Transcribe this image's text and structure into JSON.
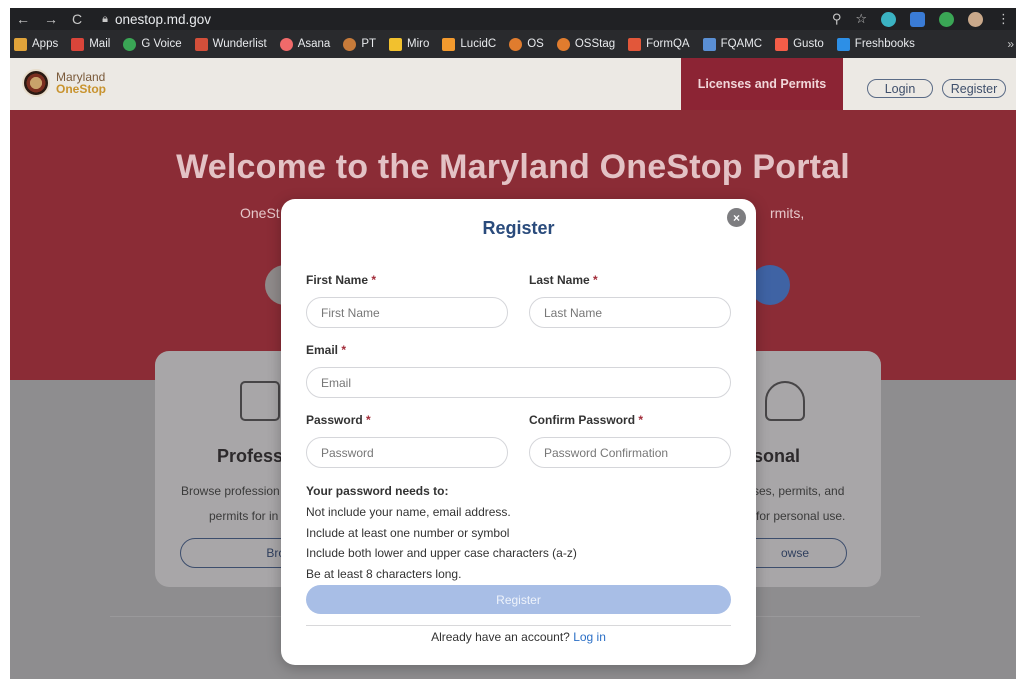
{
  "browser": {
    "url": "onestop.md.gov",
    "bookmarks": [
      "Apps",
      "Mail",
      "G Voice",
      "Wunderlist",
      "Asana",
      "PT",
      "Miro",
      "LucidC",
      "OS",
      "OSStag",
      "FormQA",
      "FQAMC",
      "Gusto",
      "Freshbooks"
    ],
    "more": "»"
  },
  "header": {
    "logo_line1": "Maryland",
    "logo_line2": "OneStop",
    "tab_licenses": "Licenses and Permits",
    "login": "Login",
    "register": "Register"
  },
  "hero": {
    "title": "Welcome to the Maryland OneStop Portal",
    "sub_left": "OneSt",
    "sub_right": "rmits,"
  },
  "cards": {
    "left_title": "Profess",
    "left_text1": "Browse profession",
    "left_text2": "permits for in",
    "left_btn": "Brow",
    "right_title": "sonal",
    "right_text1": "ses, permits, and",
    "right_text2": "for personal use.",
    "right_btn": "owse"
  },
  "modal": {
    "title": "Register",
    "close": "×",
    "first_name_label": "First Name",
    "first_name_placeholder": "First Name",
    "last_name_label": "Last Name",
    "last_name_placeholder": "Last Name",
    "email_label": "Email",
    "email_placeholder": "Email",
    "password_label": "Password",
    "password_placeholder": "Password",
    "confirm_label": "Confirm Password",
    "confirm_placeholder": "Password Confirmation",
    "required_mark": "*",
    "pw_title": "Your password needs to:",
    "pw_rules": [
      "Not include your name, email address.",
      "Include at least one number or symbol",
      "Include both lower and upper case characters (a-z)",
      "Be at least 8 characters long."
    ],
    "submit": "Register",
    "already_text": "Already have an account?",
    "login_link": "Log in"
  }
}
